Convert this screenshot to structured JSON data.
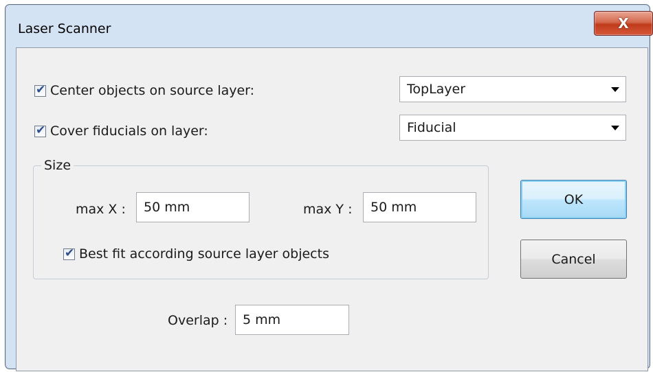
{
  "window": {
    "title": "Laser Scanner",
    "close_glyph": "X"
  },
  "center_objects": {
    "label": "Center objects on source layer:",
    "checked": true,
    "combo_value": "TopLayer"
  },
  "cover_fiducials": {
    "label": "Cover fiducials on layer:",
    "checked": true,
    "combo_value": "Fiducial"
  },
  "size_group": {
    "label": "Size",
    "max_x_label": "max X :",
    "max_x_value": "50 mm",
    "max_y_label": "max Y :",
    "max_y_value": "50 mm",
    "best_fit_label": "Best fit according source layer objects",
    "best_fit_checked": true
  },
  "overlap": {
    "label": "Overlap :",
    "value": "5 mm"
  },
  "buttons": {
    "ok": "OK",
    "cancel": "Cancel"
  },
  "icons": {
    "check": "check-mark-icon",
    "dropdown": "chevron-down-icon",
    "close": "close-icon"
  }
}
